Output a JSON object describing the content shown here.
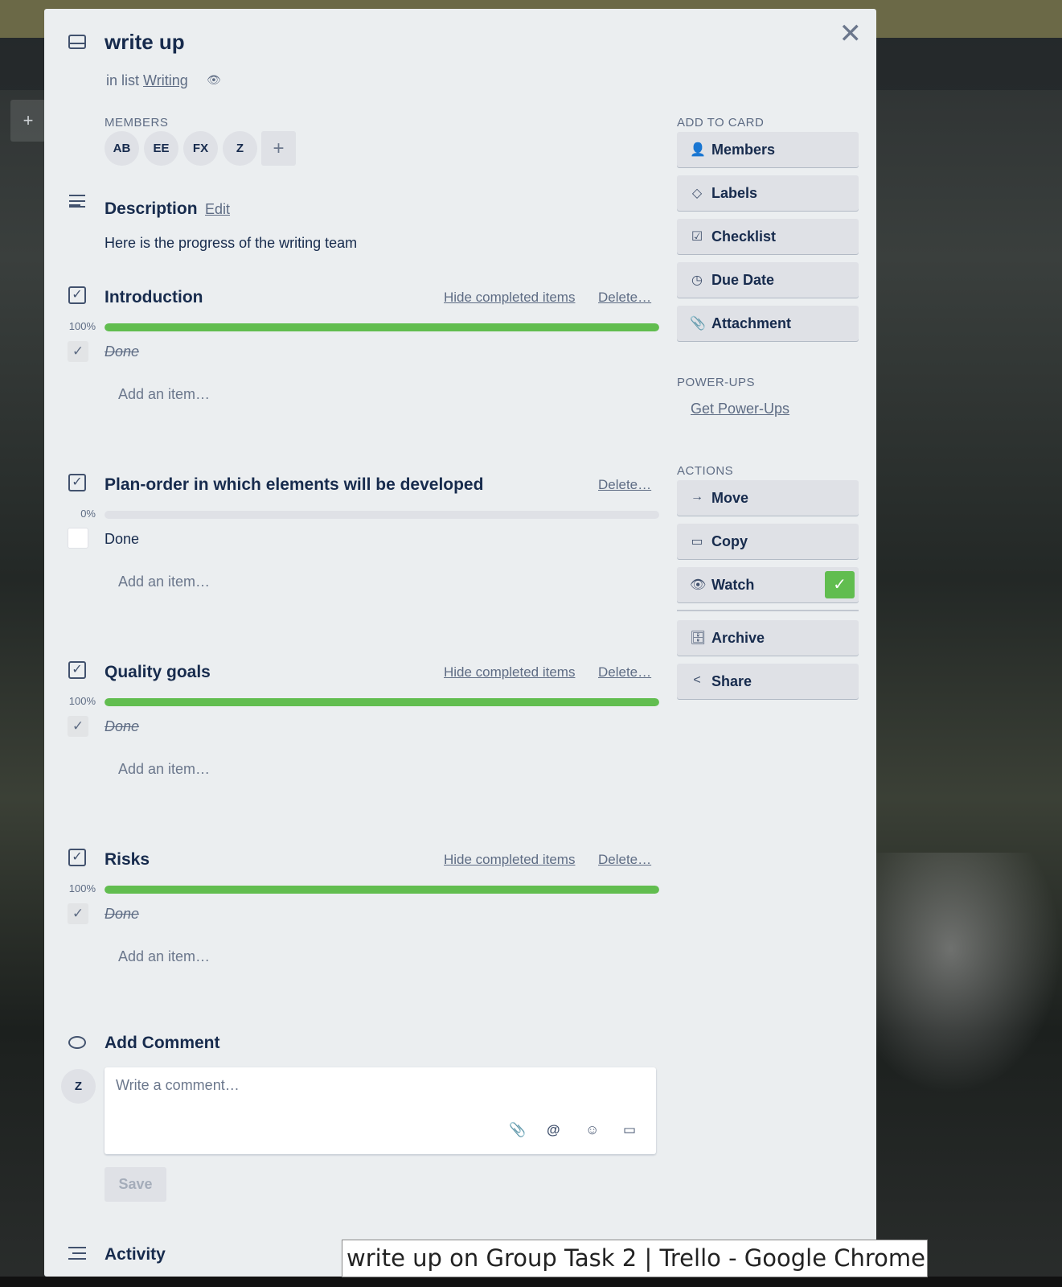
{
  "background": {
    "add_symbol": "+"
  },
  "card": {
    "title": "write up",
    "in_list_prefix": "in list",
    "list_name": "Writing"
  },
  "members": {
    "heading": "MEMBERS",
    "avatars": [
      "AB",
      "EE",
      "FX",
      "Z"
    ],
    "add_symbol": "+"
  },
  "description": {
    "heading": "Description",
    "edit_label": "Edit",
    "text": "Here is the progress of the writing team"
  },
  "checklists": [
    {
      "title": "Introduction",
      "hide_label": "Hide completed items",
      "delete_label": "Delete…",
      "percent_label": "100%",
      "progress": 1.0,
      "item": "Done",
      "checked": true,
      "add_item": "Add an item…"
    },
    {
      "title": "Plan-order in which elements will be developed",
      "delete_label": "Delete…",
      "percent_label": "0%",
      "progress": 0.0,
      "item": "Done",
      "checked": false,
      "add_item": "Add an item…"
    },
    {
      "title": "Quality goals",
      "hide_label": "Hide completed items",
      "delete_label": "Delete…",
      "percent_label": "100%",
      "progress": 1.0,
      "item": "Done",
      "checked": true,
      "add_item": "Add an item…"
    },
    {
      "title": "Risks",
      "hide_label": "Hide completed items",
      "delete_label": "Delete…",
      "percent_label": "100%",
      "progress": 1.0,
      "item": "Done",
      "checked": true,
      "add_item": "Add an item…"
    }
  ],
  "comment": {
    "heading": "Add Comment",
    "avatar": "Z",
    "placeholder": "Write a comment…",
    "save_label": "Save"
  },
  "activity": {
    "heading": "Activity"
  },
  "sidebar": {
    "add_to_card_heading": "ADD TO CARD",
    "add_buttons": [
      {
        "label": "Members",
        "icon": "person-icon"
      },
      {
        "label": "Labels",
        "icon": "tag-icon"
      },
      {
        "label": "Checklist",
        "icon": "checkbox-icon"
      },
      {
        "label": "Due Date",
        "icon": "clock-icon"
      },
      {
        "label": "Attachment",
        "icon": "paperclip-icon"
      }
    ],
    "powerups_heading": "POWER-UPS",
    "get_powerups": "Get Power-Ups",
    "actions_heading": "ACTIONS",
    "action_buttons": [
      {
        "label": "Move",
        "icon": "arrow-right-icon"
      },
      {
        "label": "Copy",
        "icon": "card-icon"
      },
      {
        "label": "Watch",
        "icon": "eye-icon",
        "active": true
      },
      {
        "label": "Archive",
        "icon": "archive-icon"
      },
      {
        "label": "Share",
        "icon": "share-icon"
      }
    ]
  },
  "window_tooltip": "write up on Group Task 2 | Trello - Google Chrome",
  "colors": {
    "progress_green": "#61bd4f",
    "modal_bg": "#ebeef0",
    "button_bg": "#dfe1e6"
  }
}
